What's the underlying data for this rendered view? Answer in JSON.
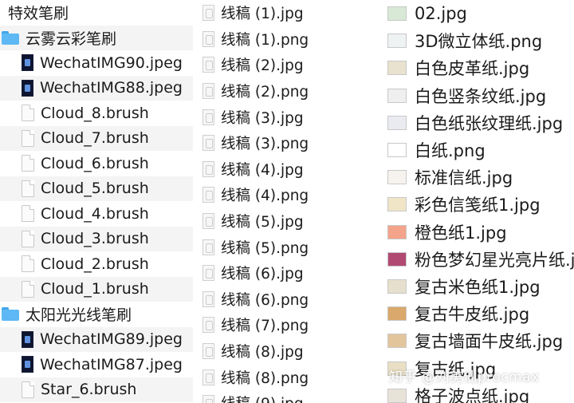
{
  "column1": {
    "header": "特效笔刷",
    "folder1": "云雾云彩笔刷",
    "folder1_items": [
      {
        "name": "WechatIMG90.jpeg",
        "kind": "image"
      },
      {
        "name": "WechatIMG88.jpeg",
        "kind": "image"
      },
      {
        "name": "Cloud_8.brush",
        "kind": "doc"
      },
      {
        "name": "Cloud_7.brush",
        "kind": "doc"
      },
      {
        "name": "Cloud_6.brush",
        "kind": "doc"
      },
      {
        "name": "Cloud_5.brush",
        "kind": "doc"
      },
      {
        "name": "Cloud_4.brush",
        "kind": "doc"
      },
      {
        "name": "Cloud_3.brush",
        "kind": "doc"
      },
      {
        "name": "Cloud_2.brush",
        "kind": "doc"
      },
      {
        "name": "Cloud_1.brush",
        "kind": "doc"
      }
    ],
    "folder2": "太阳光光线笔刷",
    "folder2_items": [
      {
        "name": "WechatIMG89.jpeg",
        "kind": "image"
      },
      {
        "name": "WechatIMG87.jpeg",
        "kind": "image"
      },
      {
        "name": "Star_6.brush",
        "kind": "doc"
      }
    ]
  },
  "column2": {
    "items": [
      "线稿 (1).jpg",
      "线稿 (1).png",
      "线稿 (2).jpg",
      "线稿 (2).png",
      "线稿 (3).jpg",
      "线稿 (3).png",
      "线稿 (4).jpg",
      "线稿 (4).png",
      "线稿 (5).jpg",
      "线稿 (5).png",
      "线稿 (6).jpg",
      "线稿 (6).png",
      "线稿 (7).png",
      "线稿 (8).jpg",
      "线稿 (8).png",
      "线稿 (9).jpg"
    ]
  },
  "column3": {
    "items": [
      {
        "name": "02.jpg",
        "color": "#d8ead6"
      },
      {
        "name": "3D微立体纸.png",
        "color": "#eef2f3"
      },
      {
        "name": "白色皮革纸.jpg",
        "color": "#e8e2cf"
      },
      {
        "name": "白色竖条纹纸.jpg",
        "color": "#efefef"
      },
      {
        "name": "白色纸张纹理纸.jpg",
        "color": "#e9ebf0"
      },
      {
        "name": "白纸.png",
        "color": "#ffffff"
      },
      {
        "name": "标准信纸.jpg",
        "color": "#f6f3ee"
      },
      {
        "name": "彩色信笺纸1.jpg",
        "color": "#f1e5c8"
      },
      {
        "name": "橙色纸1.jpg",
        "color": "#f3a48a"
      },
      {
        "name": "粉色梦幻星光亮片纸.jpg",
        "color": "#b04a72"
      },
      {
        "name": "复古米色纸1.jpg",
        "color": "#e6dfcd"
      },
      {
        "name": "复古牛皮纸.jpg",
        "color": "#d9a86a"
      },
      {
        "name": "复古墙面牛皮纸.jpg",
        "color": "#e3c59c"
      },
      {
        "name": "复古纸.jpg",
        "color": "#e9dfc4"
      },
      {
        "name": "格子波点纸.jpg",
        "color": "#e8e3d8"
      }
    ]
  },
  "watermark": "知乎 @刘美仙procmax"
}
